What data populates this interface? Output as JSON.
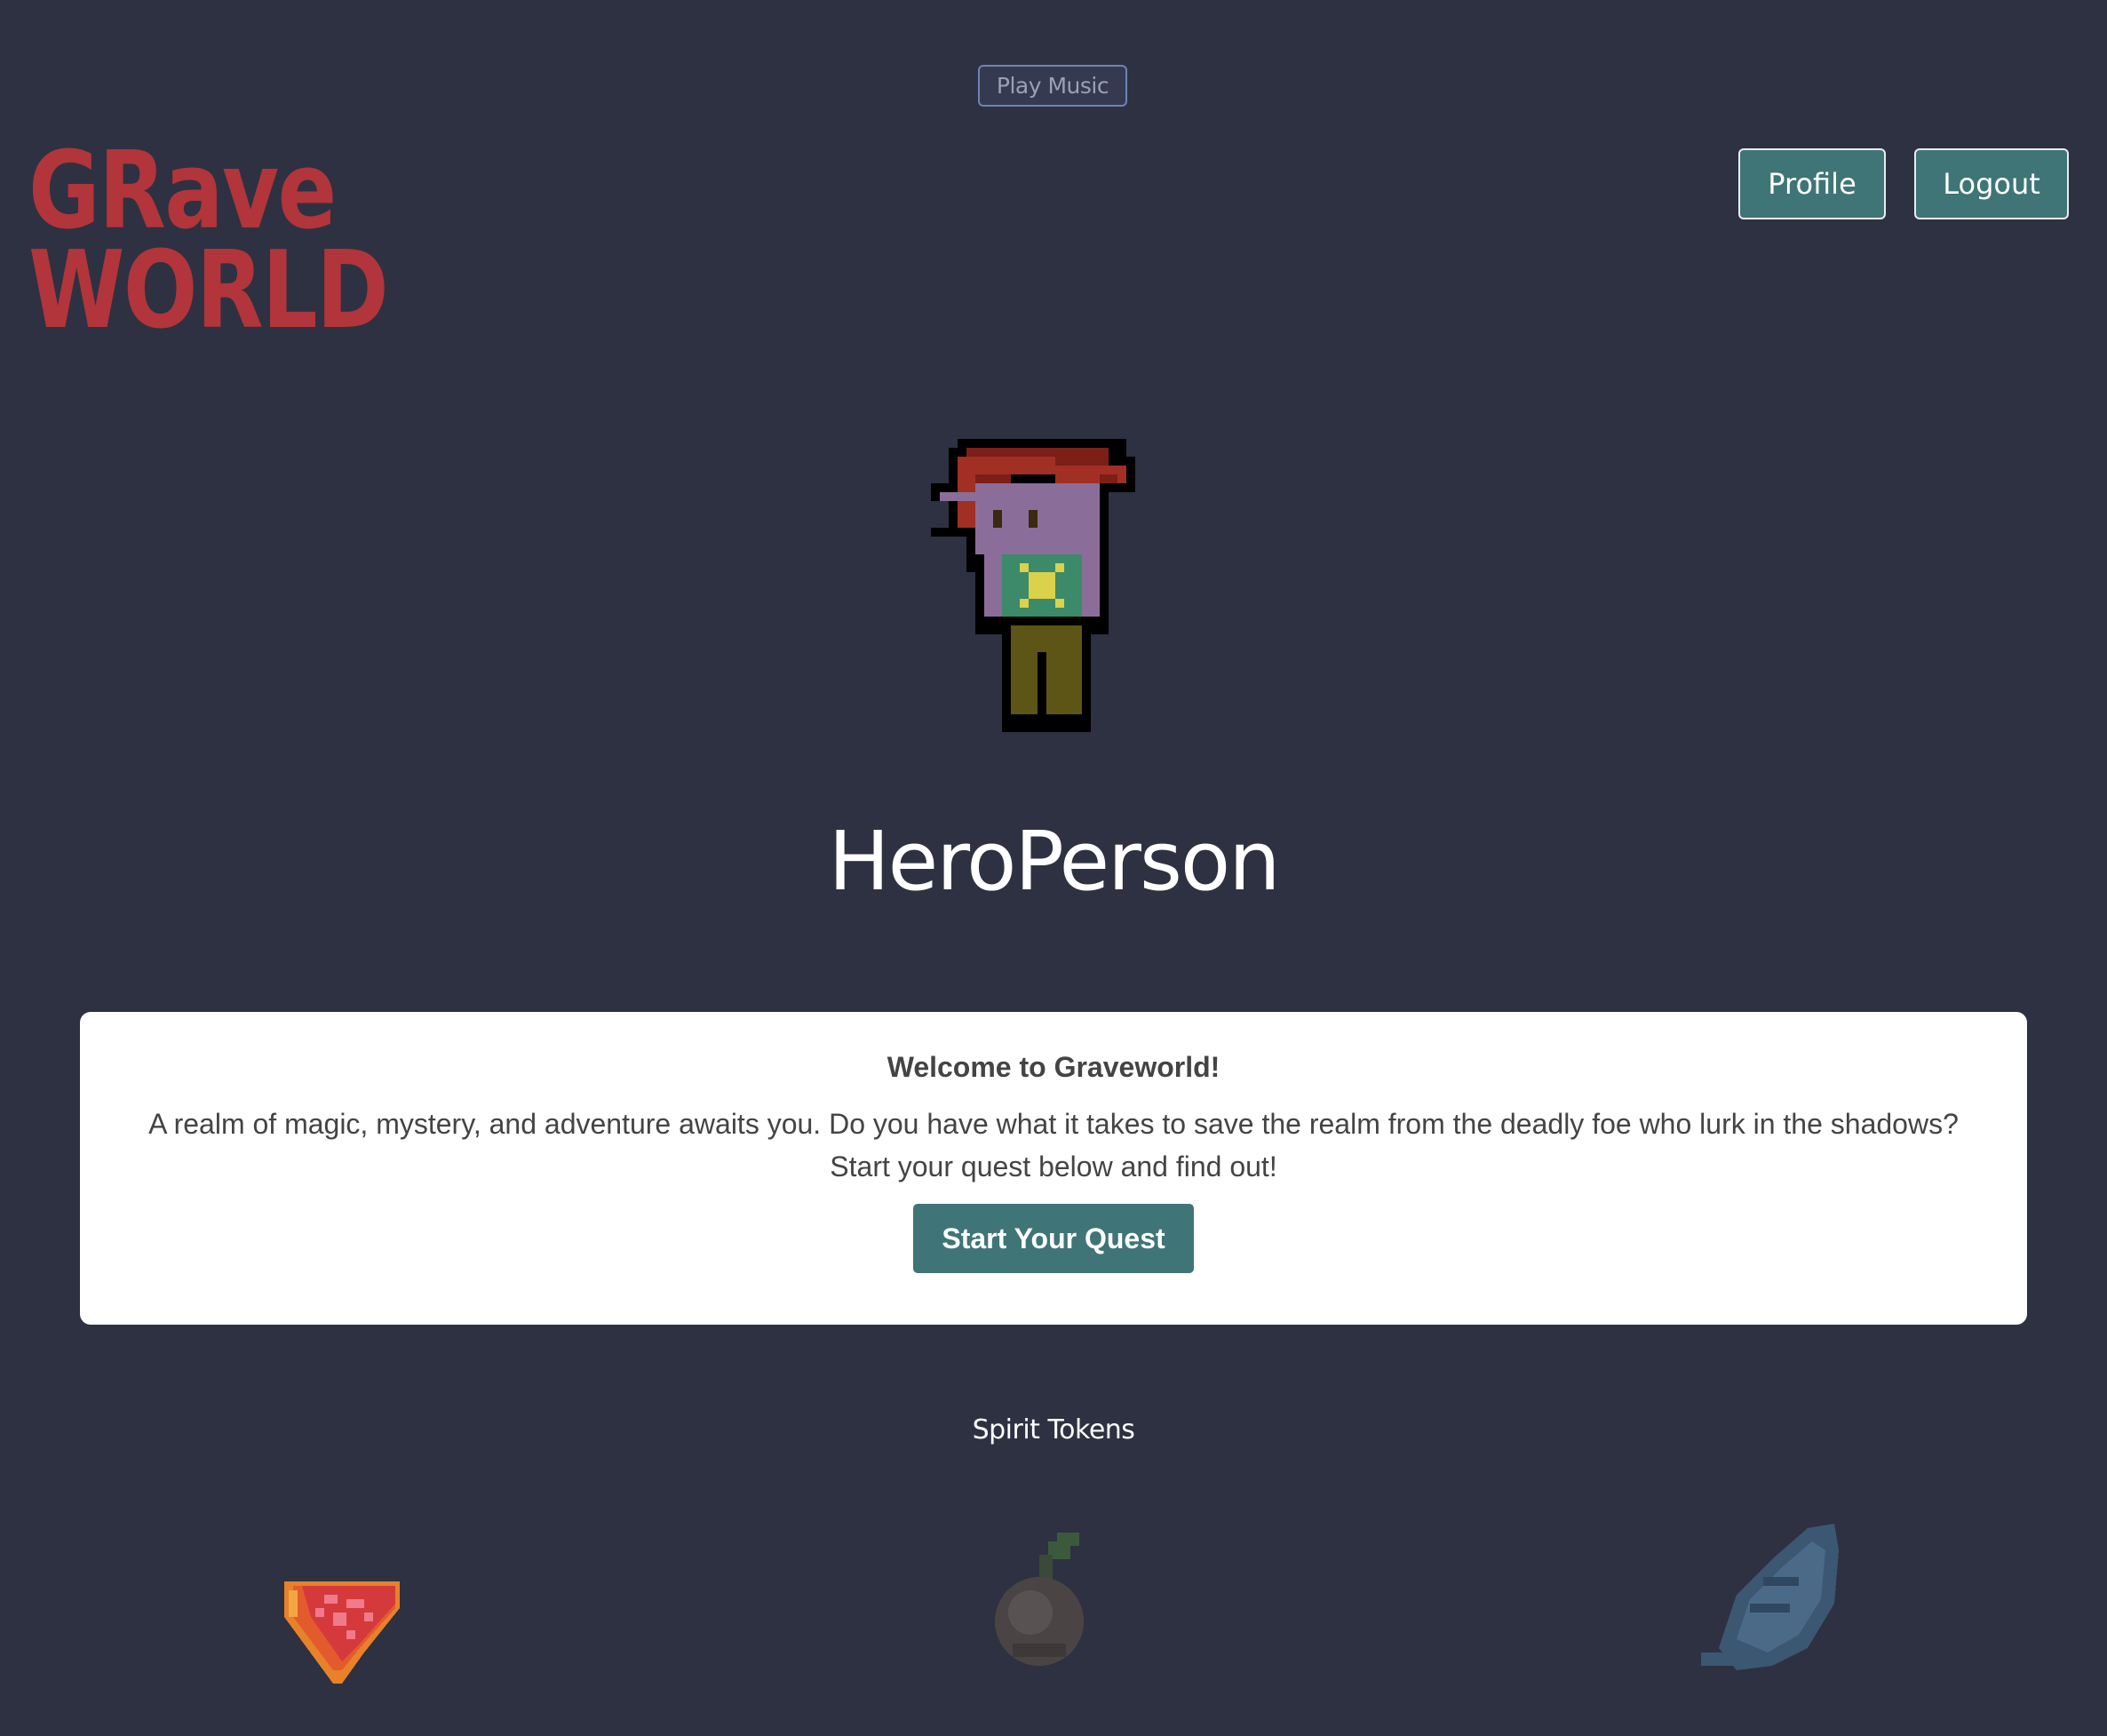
{
  "header": {
    "music_button_label": "Play Music",
    "logo": {
      "line1": "GRave",
      "line2": "WORLD",
      "color": "#b1353a"
    },
    "nav": {
      "profile_label": "Profile",
      "logout_label": "Logout"
    }
  },
  "hero": {
    "name": "HeroPerson",
    "sprite_icon": "hero-character-icon"
  },
  "welcome": {
    "title": "Welcome to Graveworld!",
    "text": "A realm of magic, mystery, and adventure awaits you. Do you have what it takes to save the realm from the deadly foe who lurk in the shadows? Start your quest below and find out!",
    "button_label": "Start Your Quest"
  },
  "spirit_tokens": {
    "title": "Spirit Tokens",
    "items": [
      {
        "icon": "heart-gem-token-icon",
        "state": "collected"
      },
      {
        "icon": "seed-token-icon",
        "state": "locked"
      },
      {
        "icon": "feather-token-icon",
        "state": "locked"
      }
    ]
  },
  "colors": {
    "background": "#2e3141",
    "button": "#3f7577",
    "card": "#ffffff",
    "text_dark": "#444444"
  }
}
